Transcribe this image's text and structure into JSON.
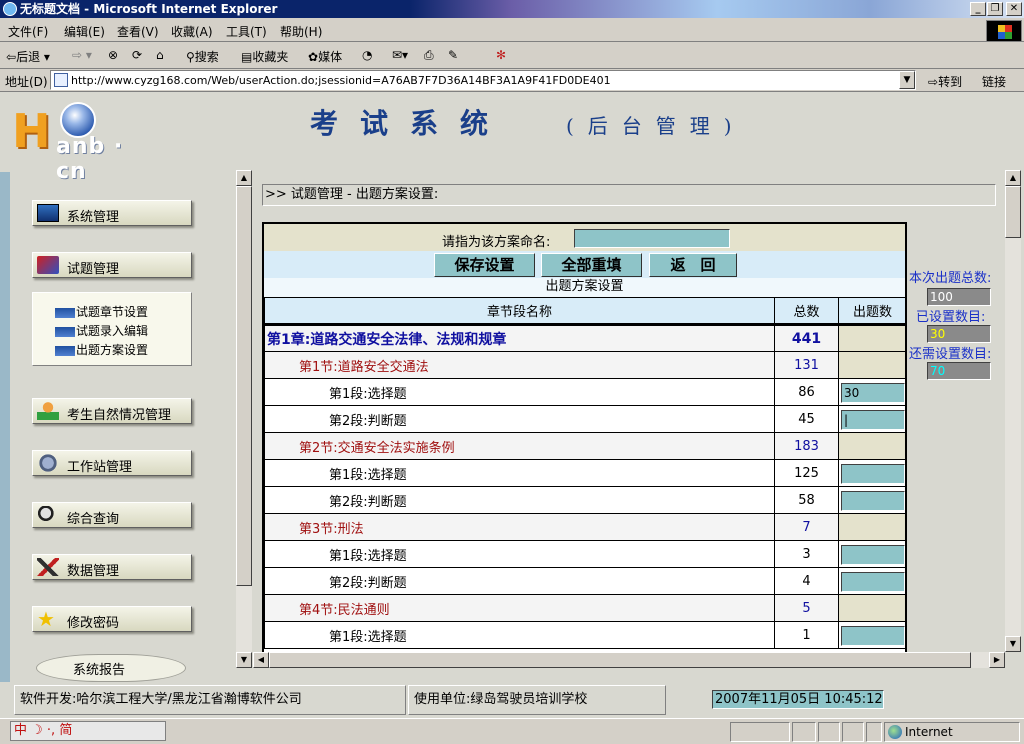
{
  "window": {
    "title": "无标题文档 - Microsoft Internet Explorer",
    "buttons": [
      "_",
      "❐",
      "✕"
    ]
  },
  "menu": [
    "文件(F)",
    "编辑(E)",
    "查看(V)",
    "收藏(A)",
    "工具(T)",
    "帮助(H)"
  ],
  "toolbar": {
    "back": "后退",
    "search": "搜索",
    "favorites": "收藏夹",
    "media": "媒体"
  },
  "address": {
    "label": "地址(D)",
    "url": "http://www.cyzg168.com/Web/userAction.do;jsessionid=A76AB7F7D36A14BF3A1A9F41FD0DE401",
    "go": "转到",
    "links": "链接"
  },
  "banner": {
    "logo_h": "H",
    "logo_rest": "anb · cn",
    "system_title": "考试系统",
    "subtitle": "(后台管理)"
  },
  "nav": {
    "items": [
      "系统管理",
      "试题管理",
      "考生自然情况管理",
      "工作站管理",
      "综合查询",
      "数据管理",
      "修改密码",
      "系统报告"
    ],
    "sub_items": [
      "试题章节设置",
      "试题录入编辑",
      "出题方案设置"
    ]
  },
  "breadcrumb": ">> 试题管理 - 出题方案设置:",
  "form": {
    "name_label": "请指为该方案命名:",
    "name_value": "",
    "save": "保存设置",
    "reset": "全部重填",
    "back": "返　回",
    "caption": "出题方案设置",
    "col_name": "章节段名称",
    "col_total": "总数",
    "col_count": "出题数"
  },
  "rows": [
    {
      "type": "chapter",
      "name": "第1章:道路交通安全法律、法规和规章",
      "total": "441",
      "count": ""
    },
    {
      "type": "section",
      "name": "第1节:道路安全交通法",
      "total": "131",
      "count": ""
    },
    {
      "type": "segment",
      "name": "第1段:选择题",
      "total": "86",
      "count": "30"
    },
    {
      "type": "segment",
      "name": "第2段:判断题",
      "total": "45",
      "count": "|"
    },
    {
      "type": "section",
      "name": "第2节:交通安全法实施条例",
      "total": "183",
      "count": ""
    },
    {
      "type": "segment",
      "name": "第1段:选择题",
      "total": "125",
      "count": ""
    },
    {
      "type": "segment",
      "name": "第2段:判断题",
      "total": "58",
      "count": ""
    },
    {
      "type": "section",
      "name": "第3节:刑法",
      "total": "7",
      "count": ""
    },
    {
      "type": "segment",
      "name": "第1段:选择题",
      "total": "3",
      "count": ""
    },
    {
      "type": "segment",
      "name": "第2段:判断题",
      "total": "4",
      "count": ""
    },
    {
      "type": "section",
      "name": "第4节:民法通则",
      "total": "5",
      "count": ""
    },
    {
      "type": "segment",
      "name": "第1段:选择题",
      "total": "1",
      "count": ""
    }
  ],
  "side": {
    "total_label": "本次出题总数:",
    "total_value": "100",
    "set_label": "已设置数目:",
    "set_value": "30",
    "remain_label": "还需设置数目:",
    "remain_value": "70",
    "colors": {
      "total": "#ffffff",
      "set": "#ffff00",
      "remain": "#00ffff"
    }
  },
  "footer": {
    "developer": "软件开发:哈尔滨工程大学/黑龙江省瀚博软件公司",
    "user": "使用单位:绿岛驾驶员培训学校",
    "clock": "2007年11月05日  10:45:12"
  },
  "status": {
    "ime": "中 ☽ ·, 简",
    "zone": "Internet"
  }
}
